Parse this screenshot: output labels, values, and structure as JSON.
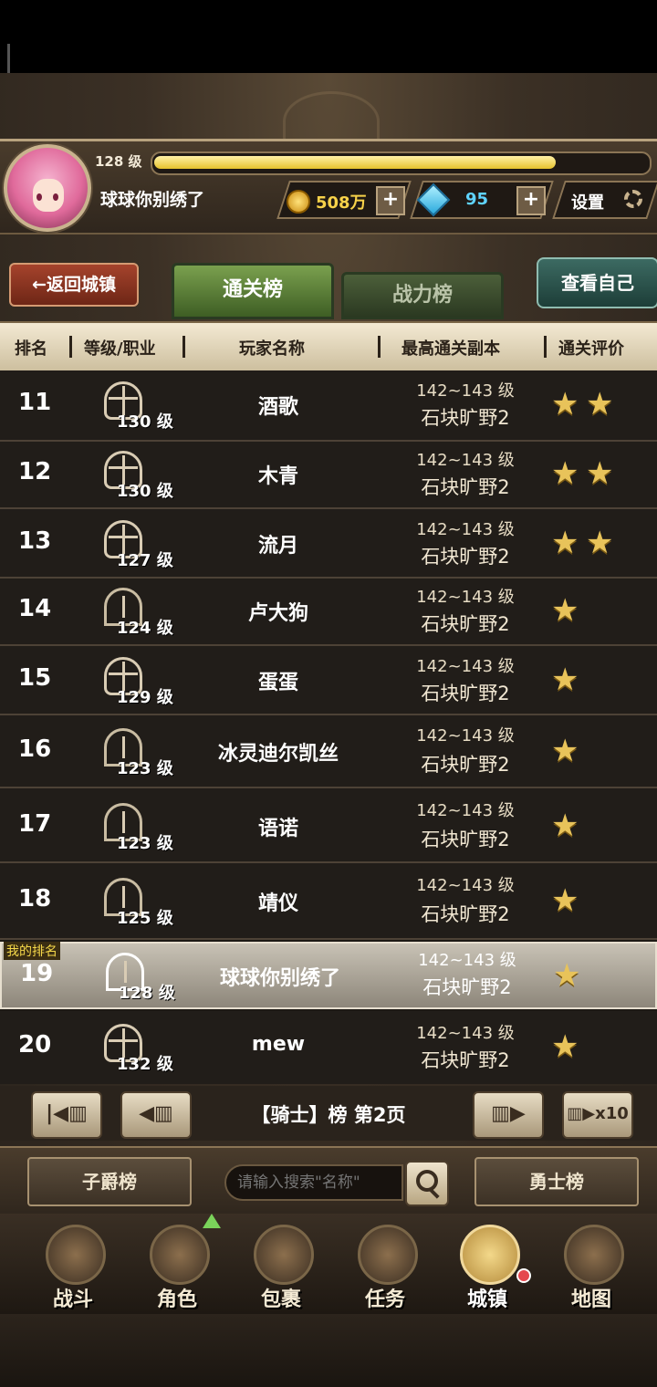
{
  "header": {
    "level": "128 级",
    "xp_fraction": 0.82,
    "player_name": "球球你别绣了",
    "gold": "508万",
    "gems": "95",
    "settings_label": "设置",
    "plus": "+"
  },
  "tabs": {
    "back": "←返回城镇",
    "clear_rank": "通关榜",
    "power_rank": "战力榜",
    "view_self": "查看自己"
  },
  "columns": [
    "排名",
    "等级/职业",
    "玩家名称",
    "最高通关副本",
    "通关评价"
  ],
  "my_rank_badge": "我的排名",
  "rows": [
    {
      "rank": "11",
      "level": "130 级",
      "name": "酒歌",
      "range": "142~143 级",
      "dungeon": "石块旷野2",
      "stars": 2,
      "icon": "cross-shield-icon"
    },
    {
      "rank": "12",
      "level": "130 级",
      "name": "木青",
      "range": "142~143 级",
      "dungeon": "石块旷野2",
      "stars": 2,
      "icon": "cross-shield-icon"
    },
    {
      "rank": "13",
      "level": "127 级",
      "name": "流月",
      "range": "142~143 级",
      "dungeon": "石块旷野2",
      "stars": 2,
      "icon": "cross-shield-icon"
    },
    {
      "rank": "14",
      "level": "124 级",
      "name": "卢大狗",
      "range": "142~143 级",
      "dungeon": "石块旷野2",
      "stars": 1,
      "icon": "ranger-icon"
    },
    {
      "rank": "15",
      "level": "129 级",
      "name": "蛋蛋",
      "range": "142~143 级",
      "dungeon": "石块旷野2",
      "stars": 1,
      "icon": "cross-shield-icon"
    },
    {
      "rank": "16",
      "level": "123 级",
      "name": "冰灵迪尔凯丝",
      "range": "142~143 级",
      "dungeon": "石块旷野2",
      "stars": 1,
      "icon": "flame-crest-icon"
    },
    {
      "rank": "17",
      "level": "123 级",
      "name": "语诺",
      "range": "142~143 级",
      "dungeon": "石块旷野2",
      "stars": 1,
      "icon": "flame-crest-icon"
    },
    {
      "rank": "18",
      "level": "125 级",
      "name": "靖仪",
      "range": "142~143 级",
      "dungeon": "石块旷野2",
      "stars": 1,
      "icon": "flame-crest-icon"
    },
    {
      "rank": "19",
      "level": "128 级",
      "name": "球球你别绣了",
      "range": "142~143 级",
      "dungeon": "石块旷野2",
      "stars": 1,
      "icon": "flame-crest-icon",
      "me": true
    },
    {
      "rank": "20",
      "level": "132 级",
      "name": "mew",
      "range": "142~143 级",
      "dungeon": "石块旷野2",
      "stars": 1,
      "icon": "cross-shield-icon"
    }
  ],
  "pager": {
    "first": "|◀▥",
    "prev": "◀▥",
    "label": "【骑士】榜 第2页",
    "next": "▥▶",
    "next10": "▥▶x10"
  },
  "search": {
    "left_button": "子爵榜",
    "placeholder": "请输入搜索\"名称\"",
    "right_button": "勇士榜"
  },
  "nav": [
    {
      "label": "战斗",
      "icon": "battle-icon"
    },
    {
      "label": "角色",
      "icon": "character-icon"
    },
    {
      "label": "包裹",
      "icon": "bag-icon"
    },
    {
      "label": "任务",
      "icon": "quest-icon"
    },
    {
      "label": "城镇",
      "icon": "town-icon",
      "active": true
    },
    {
      "label": "地图",
      "icon": "map-icon"
    }
  ],
  "colors": {
    "accent_gold": "#e8c35a",
    "tab_green": "#5f8a3c",
    "back_red": "#8a3420"
  }
}
